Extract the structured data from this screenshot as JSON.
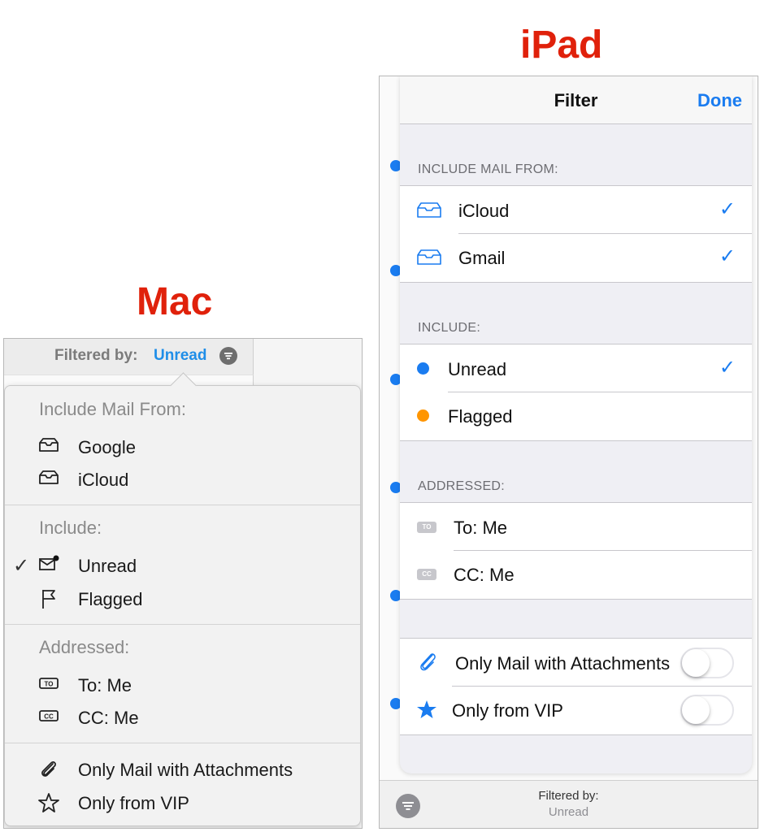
{
  "headings": {
    "mac": "Mac",
    "ipad": "iPad"
  },
  "colors": {
    "heading_red": "#e0210b",
    "accent_blue": "#1a7cf0",
    "flag_orange": "#ff9500"
  },
  "mac": {
    "filter_bar": {
      "label": "Filtered by:",
      "value": "Unread",
      "icon": "filter-circle-icon"
    },
    "popover": {
      "include_mail_from": {
        "header": "Include Mail From:",
        "items": [
          {
            "label": "Google",
            "icon": "inbox-tray-icon"
          },
          {
            "label": "iCloud",
            "icon": "inbox-tray-icon"
          }
        ]
      },
      "include": {
        "header": "Include:",
        "items": [
          {
            "label": "Unread",
            "icon": "unread-envelope-icon",
            "checked": true,
            "check": "✓"
          },
          {
            "label": "Flagged",
            "icon": "flag-icon",
            "checked": false
          }
        ]
      },
      "addressed": {
        "header": "Addressed:",
        "items": [
          {
            "label": "To: Me",
            "icon": "to-badge-icon"
          },
          {
            "label": "CC: Me",
            "icon": "cc-badge-icon"
          }
        ]
      },
      "other": {
        "items": [
          {
            "label": "Only Mail with Attachments",
            "icon": "paperclip-icon"
          },
          {
            "label": "Only from VIP",
            "icon": "star-outline-icon"
          }
        ]
      }
    }
  },
  "ipad": {
    "navbar": {
      "title": "Filter",
      "done": "Done"
    },
    "include_mail_from": {
      "header": "INCLUDE MAIL FROM:",
      "items": [
        {
          "label": "iCloud",
          "icon": "inbox-tray-icon",
          "checked": true,
          "check": "✓"
        },
        {
          "label": "Gmail",
          "icon": "inbox-tray-icon",
          "checked": true,
          "check": "✓"
        }
      ]
    },
    "include": {
      "header": "INCLUDE:",
      "items": [
        {
          "label": "Unread",
          "icon": "blue-dot-icon",
          "checked": true,
          "check": "✓"
        },
        {
          "label": "Flagged",
          "icon": "orange-dot-icon",
          "checked": false
        }
      ]
    },
    "addressed": {
      "header": "ADDRESSED:",
      "items": [
        {
          "label": "To: Me",
          "badge": "TO"
        },
        {
          "label": "CC: Me",
          "badge": "CC"
        }
      ]
    },
    "toggles": [
      {
        "label": "Only Mail with Attachments",
        "icon": "paperclip-icon",
        "on": false
      },
      {
        "label": "Only from VIP",
        "icon": "star-icon",
        "on": false
      }
    ],
    "bottom_bar": {
      "label": "Filtered by:",
      "value": "Unread",
      "icon": "filter-circle-icon"
    }
  }
}
